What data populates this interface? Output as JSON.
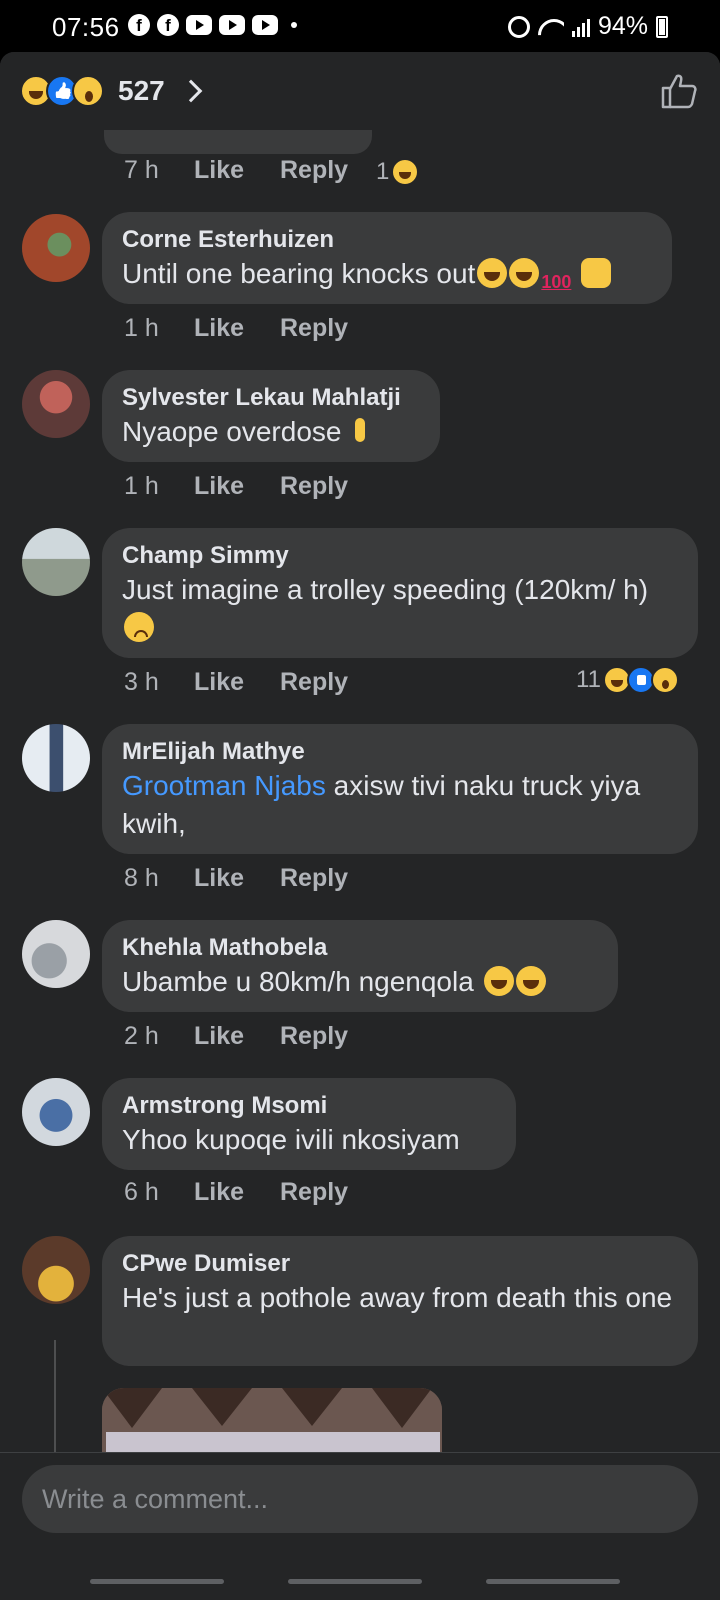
{
  "status_bar": {
    "time": "07:56",
    "battery": "94%"
  },
  "reaction_summary": {
    "count": "527",
    "icons": [
      "haha-icon",
      "like-icon",
      "wow-icon"
    ]
  },
  "first_actions": {
    "time": "7 h",
    "like": "Like",
    "reply": "Reply",
    "reaction_count": "1"
  },
  "comments": [
    {
      "author": "Corne Esterhuizen",
      "text": "Until one bearing knocks out",
      "emoji_suffix": [
        "laugh",
        "laugh",
        "100",
        "raised-hands"
      ],
      "time": "1 h",
      "like": "Like",
      "reply": "Reply"
    },
    {
      "author": "Sylvester Lekau Mahlatji",
      "text": "Nyaope overdose",
      "emoji_suffix": [
        "crossed-fingers"
      ],
      "time": "1 h",
      "like": "Like",
      "reply": "Reply"
    },
    {
      "author": "Champ Simmy",
      "text": "Just imagine a trolley speeding (120km/ h)",
      "emoji_suffix": [
        "pleading"
      ],
      "time": "3 h",
      "like": "Like",
      "reply": "Reply",
      "reaction_count": "11"
    },
    {
      "author": "MrElijah Mathye",
      "mention": "Grootman Njabs",
      "text": " axisw tivi naku truck yiya kwih,",
      "time": "8 h",
      "like": "Like",
      "reply": "Reply"
    },
    {
      "author": "Khehla Mathobela",
      "text": "Ubambe u 80km/h ngenqola ",
      "emoji_suffix": [
        "laugh",
        "laugh"
      ],
      "time": "2 h",
      "like": "Like",
      "reply": "Reply"
    },
    {
      "author": "Armstrong Msomi",
      "text": "Yhoo kupoqe ivili nkosiyam",
      "time": "6 h",
      "like": "Like",
      "reply": "Reply"
    },
    {
      "author": "CPwe Dumiser",
      "text": "He's just a pothole away from death this one"
    }
  ],
  "composer": {
    "placeholder": "Write a comment..."
  },
  "colors": {
    "background": "#242526",
    "bubble": "#3a3b3c",
    "mention": "#4599ff",
    "muted_text": "#b0b3b8"
  }
}
